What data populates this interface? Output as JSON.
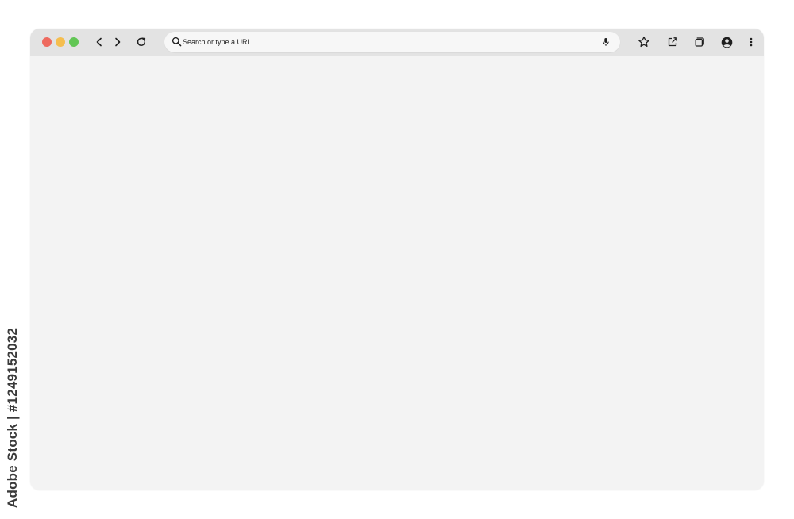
{
  "window": {
    "traffic_lights": {
      "close_color": "#ee6a5f",
      "minimize_color": "#f5be4f",
      "maximize_color": "#62c655"
    }
  },
  "toolbar": {
    "icons": {
      "back": "chevron-left-icon",
      "forward": "chevron-right-icon",
      "reload": "reload-icon",
      "bookmark": "star-icon",
      "share": "share-icon",
      "tabs": "tabs-icon",
      "profile": "account-icon",
      "menu": "more-vertical-icon"
    }
  },
  "address_bar": {
    "placeholder": "Search or type a URL",
    "value": "",
    "search_icon": "search-icon",
    "mic_icon": "microphone-icon"
  },
  "watermark": {
    "side_text": "Adobe Stock | #1249152032"
  }
}
